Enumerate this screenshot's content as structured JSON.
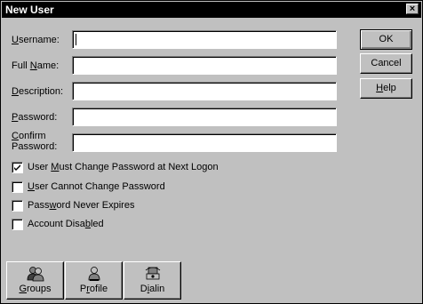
{
  "window": {
    "title": "New User",
    "close_glyph": "×"
  },
  "form": {
    "username": {
      "label_ul": "U",
      "label_rest": "sername:",
      "value": ""
    },
    "fullname": {
      "label_pre": "Full ",
      "label_ul": "N",
      "label_rest": "ame:",
      "value": ""
    },
    "description": {
      "label_ul": "D",
      "label_rest": "escription:",
      "value": ""
    },
    "password": {
      "label_ul": "P",
      "label_rest": "assword:",
      "value": ""
    },
    "confirm": {
      "label_line1_ul": "C",
      "label_line1_rest": "onfirm",
      "label_line2": "Password:",
      "value": ""
    }
  },
  "buttons": {
    "ok": "OK",
    "cancel": "Cancel",
    "help_ul": "H",
    "help_rest": "elp"
  },
  "checkboxes": [
    {
      "pre": "User ",
      "ul": "M",
      "rest": "ust Change Password at Next Logon",
      "checked": true
    },
    {
      "pre": "",
      "ul": "U",
      "rest": "ser Cannot Change Password",
      "checked": false
    },
    {
      "pre": "Pass",
      "ul": "w",
      "rest": "ord Never Expires",
      "checked": false
    },
    {
      "pre": "Account Disa",
      "ul": "b",
      "rest": "led",
      "checked": false
    }
  ],
  "bottom_buttons": {
    "groups": {
      "ul": "G",
      "rest": "roups",
      "icon": "groups-icon"
    },
    "profile": {
      "pre": "P",
      "ul": "r",
      "rest": "ofile",
      "icon": "profile-icon"
    },
    "dialin": {
      "pre": "D",
      "ul": "i",
      "rest": "alin",
      "icon": "dialin-icon"
    }
  }
}
